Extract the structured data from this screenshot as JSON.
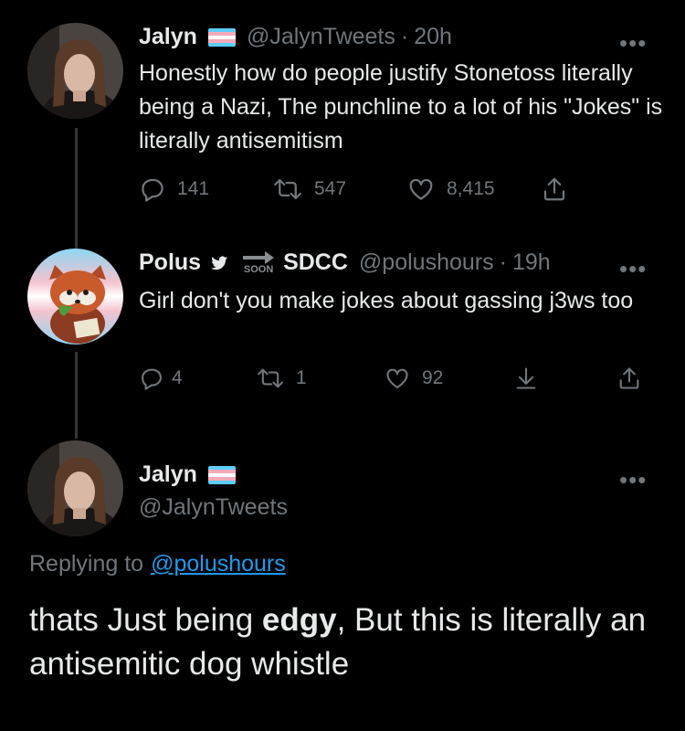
{
  "tweets": [
    {
      "name": "Jalyn",
      "handle": "@JalynTweets",
      "time": "20h",
      "text": "Honestly how do people justify Stonetoss literally being a Nazi, The punchline to a lot of his \"Jokes\" is literally antisemitism",
      "replies": "141",
      "retweets": "547",
      "likes": "8,415"
    },
    {
      "name": "Polus",
      "soon_label": "SOON",
      "name_suffix": "SDCC",
      "handle": "@polushours",
      "time": "19h",
      "text": "Girl don't you make jokes about gassing j3ws too",
      "replies": "4",
      "retweets": "1",
      "likes": "92"
    },
    {
      "name": "Jalyn",
      "handle": "@JalynTweets",
      "replying_prefix": "Replying to",
      "replying_to": "@polushours",
      "text_before": "thats Just being ",
      "text_bold": "edgy",
      "text_after": ", But this is literally an antisemitic dog whistle"
    }
  ],
  "more_glyph": "•••",
  "dot": "·",
  "colors": {
    "background": "#000000",
    "text": "#e7e9ea",
    "muted": "#71767b",
    "link": "#1d9bf0",
    "flag_blue": "#5bcefa",
    "flag_pink": "#f5a9b8",
    "flag_white": "#ffffff"
  },
  "icons": [
    "reply-icon",
    "retweet-icon",
    "like-icon",
    "share-icon",
    "download-icon",
    "twitter-bird-icon",
    "arrow-right-icon",
    "more-icon"
  ]
}
